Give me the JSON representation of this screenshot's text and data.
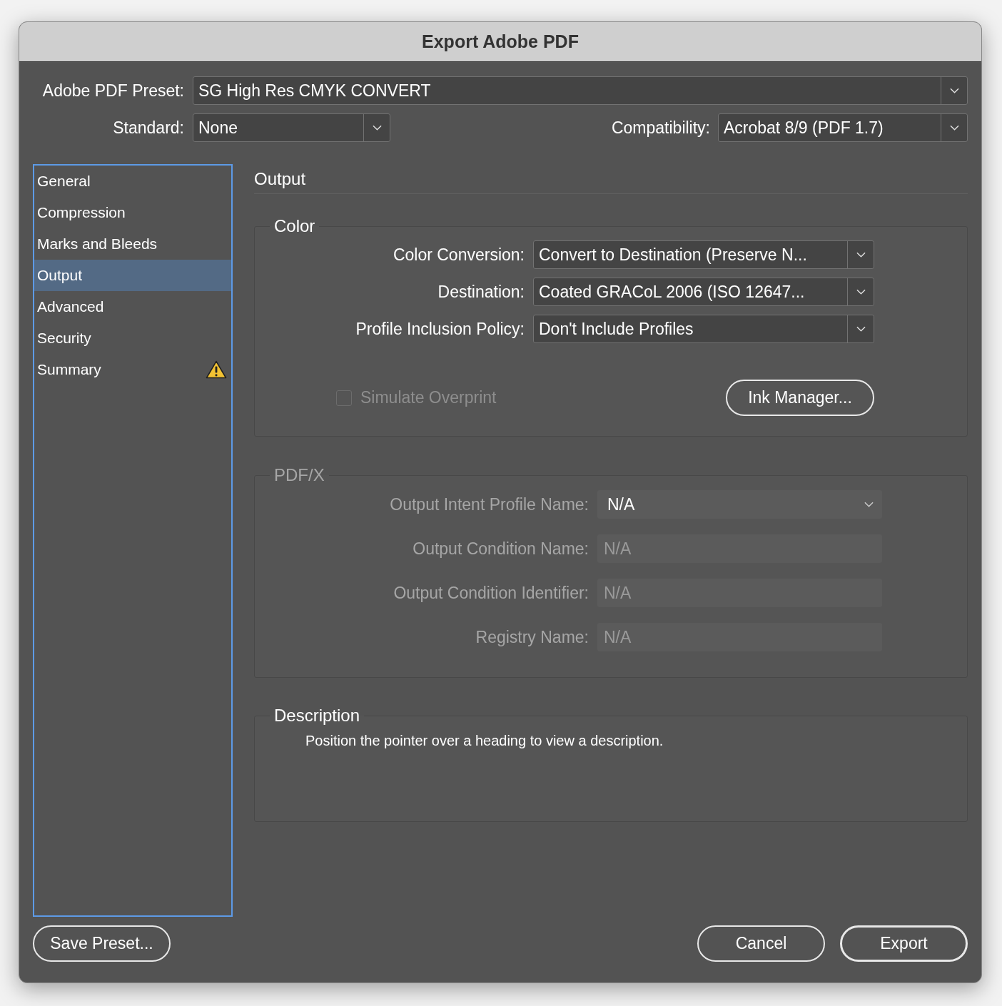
{
  "window": {
    "title": "Export Adobe PDF"
  },
  "preset": {
    "label": "Adobe PDF Preset:",
    "value": "SG High Res CMYK CONVERT"
  },
  "standard": {
    "label": "Standard:",
    "value": "None"
  },
  "compatibility": {
    "label": "Compatibility:",
    "value": "Acrobat 8/9 (PDF 1.7)"
  },
  "sidebar": {
    "items": [
      {
        "label": "General",
        "selected": false,
        "warning": false
      },
      {
        "label": "Compression",
        "selected": false,
        "warning": false
      },
      {
        "label": "Marks and Bleeds",
        "selected": false,
        "warning": false
      },
      {
        "label": "Output",
        "selected": true,
        "warning": false
      },
      {
        "label": "Advanced",
        "selected": false,
        "warning": false
      },
      {
        "label": "Security",
        "selected": false,
        "warning": false
      },
      {
        "label": "Summary",
        "selected": false,
        "warning": true
      }
    ]
  },
  "panel": {
    "title": "Output",
    "color_group": {
      "title": "Color",
      "fields": [
        {
          "label": "Color Conversion:",
          "value": "Convert to Destination (Preserve N..."
        },
        {
          "label": "Destination:",
          "value": "Coated GRACoL 2006 (ISO 12647..."
        },
        {
          "label": "Profile Inclusion Policy:",
          "value": "Don't Include Profiles"
        }
      ],
      "simulate_overprint": {
        "label": "Simulate Overprint",
        "checked": false,
        "disabled": true
      },
      "ink_manager_button": "Ink Manager..."
    },
    "pdfx_group": {
      "title": "PDF/X",
      "disabled": true,
      "fields": [
        {
          "label": "Output Intent Profile Name:",
          "value": "N/A",
          "kind": "dropdown"
        },
        {
          "label": "Output Condition Name:",
          "value": "N/A",
          "kind": "text"
        },
        {
          "label": "Output Condition Identifier:",
          "value": "N/A",
          "kind": "text"
        },
        {
          "label": "Registry Name:",
          "value": "N/A",
          "kind": "text"
        }
      ]
    },
    "description": {
      "title": "Description",
      "text": "Position the pointer over a heading to view a description."
    }
  },
  "footer": {
    "left_buttons": [
      {
        "label": "Save Preset...",
        "default": false
      }
    ],
    "right_buttons": [
      {
        "label": "Cancel",
        "default": false
      },
      {
        "label": "Export",
        "default": true
      }
    ]
  }
}
